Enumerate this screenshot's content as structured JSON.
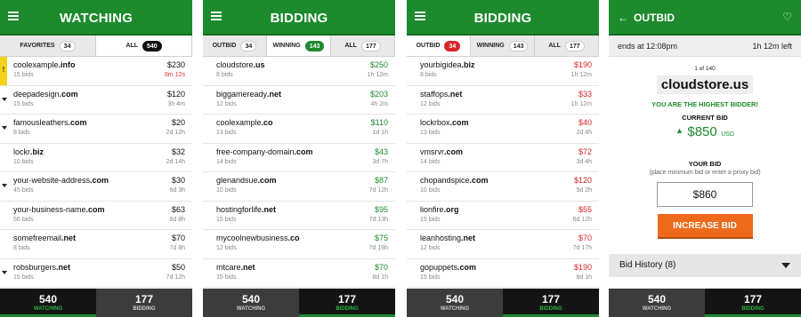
{
  "bottom_nav": {
    "watching_count": "540",
    "watching_label": "WATCHING",
    "bidding_count": "177",
    "bidding_label": "BIDDING"
  },
  "panel1": {
    "title": "WATCHING",
    "tabs": [
      {
        "label": "FAVORITES",
        "count": "34"
      },
      {
        "label": "ALL",
        "count": "540"
      }
    ],
    "rows": [
      {
        "domain": "coolexample",
        "tld": ".info",
        "bids": "15 bids",
        "price": "$230",
        "time": "6m 12s",
        "time_color": "red",
        "marker": "!"
      },
      {
        "domain": "deepadesign",
        "tld": ".com",
        "bids": "15 bids",
        "price": "$120",
        "time": "3h 4m",
        "marker": "v"
      },
      {
        "domain": "famousleathers",
        "tld": ".com",
        "bids": "8 bids",
        "price": "$20",
        "time": "2d 12h",
        "marker": "v"
      },
      {
        "domain": "lockr",
        "tld": ".biz",
        "bids": "10 bids",
        "price": "$32",
        "time": "2d 14h",
        "marker": ""
      },
      {
        "domain": "your-website-address",
        "tld": ".com",
        "bids": "45 bids",
        "price": "$30",
        "time": "6d 3h",
        "marker": "v"
      },
      {
        "domain": "your-business-name",
        "tld": ".com",
        "bids": "56 bids",
        "price": "$63",
        "time": "6d 8h",
        "marker": ""
      },
      {
        "domain": "somefreemail",
        "tld": ".net",
        "bids": "8 bids",
        "price": "$70",
        "time": "7d 8h",
        "marker": ""
      },
      {
        "domain": "robsburgers",
        "tld": ".net",
        "bids": "15 bids",
        "price": "$50",
        "time": "7d 12h",
        "marker": "v"
      }
    ]
  },
  "panel2": {
    "title": "BIDDING",
    "tabs": [
      {
        "label": "OUTBID",
        "count": "34"
      },
      {
        "label": "WINNING",
        "count": "143"
      },
      {
        "label": "ALL",
        "count": "177"
      }
    ],
    "rows": [
      {
        "domain": "cloudstore",
        "tld": ".us",
        "bids": "8 bids",
        "price": "$250",
        "time": "1h 12m"
      },
      {
        "domain": "biggameready",
        "tld": ".net",
        "bids": "12 bids",
        "price": "$203",
        "time": "4h 2m"
      },
      {
        "domain": "coolexample",
        "tld": ".co",
        "bids": "13 bids",
        "price": "$110",
        "time": "1d 1h"
      },
      {
        "domain": "free-company-domain",
        "tld": ".com",
        "bids": "14 bids",
        "price": "$43",
        "time": "3d 7h"
      },
      {
        "domain": "glenandsue",
        "tld": ".com",
        "bids": "10 bids",
        "price": "$87",
        "time": "7d 12h"
      },
      {
        "domain": "hostingforlife",
        "tld": ".net",
        "bids": "15 bids",
        "price": "$95",
        "time": "7d 13h"
      },
      {
        "domain": "mycoolnewbusiness",
        "tld": ".co",
        "bids": "12 bids",
        "price": "$75",
        "time": "7d 19h"
      },
      {
        "domain": "mtcare",
        "tld": ".net",
        "bids": "15 bids",
        "price": "$70",
        "time": "8d 1h"
      }
    ]
  },
  "panel3": {
    "title": "BIDDING",
    "tabs": [
      {
        "label": "OUTBID",
        "count": "34"
      },
      {
        "label": "WINNING",
        "count": "143"
      },
      {
        "label": "ALL",
        "count": "177"
      }
    ],
    "rows": [
      {
        "domain": "yourbigidea",
        "tld": ".biz",
        "bids": "8 bids",
        "price": "$190",
        "time": "1h 12m"
      },
      {
        "domain": "staffops",
        "tld": ".net",
        "bids": "12 bids",
        "price": "$33",
        "time": "1h 12m"
      },
      {
        "domain": "lockrbox",
        "tld": ".com",
        "bids": "13 bids",
        "price": "$40",
        "time": "2d 4h"
      },
      {
        "domain": "vmsrvr",
        "tld": ".com",
        "bids": "14 bids",
        "price": "$72",
        "time": "3d 4h"
      },
      {
        "domain": "chopandspice",
        "tld": ".com",
        "bids": "10 bids",
        "price": "$120",
        "time": "5d 2h"
      },
      {
        "domain": "lionfire",
        "tld": ".org",
        "bids": "15 bids",
        "price": "$55",
        "time": "6d 12h"
      },
      {
        "domain": "leanhosting",
        "tld": ".net",
        "bids": "12 bids",
        "price": "$70",
        "time": "7d 17h"
      },
      {
        "domain": "gopuppets",
        "tld": ".com",
        "bids": "15 bids",
        "price": "$190",
        "time": "8d 1h"
      }
    ]
  },
  "panel4": {
    "title": "OUTBID",
    "ends_at": "ends at 12:08pm",
    "time_left": "1h 12m left",
    "position": "1 of 140",
    "domain": "cloudstore",
    "tld": ".us",
    "status": "YOU ARE THE HIGHEST BIDDER!",
    "current_bid_label": "CURRENT BID",
    "current_bid": "$850",
    "currency": "USD",
    "your_bid_label": "YOUR BID",
    "your_bid_hint": "(place minimum bid or enter a proxy bid)",
    "your_bid_value": "$860",
    "increase_button": "INCREASE BID",
    "history_label": "Bid History (8)"
  }
}
